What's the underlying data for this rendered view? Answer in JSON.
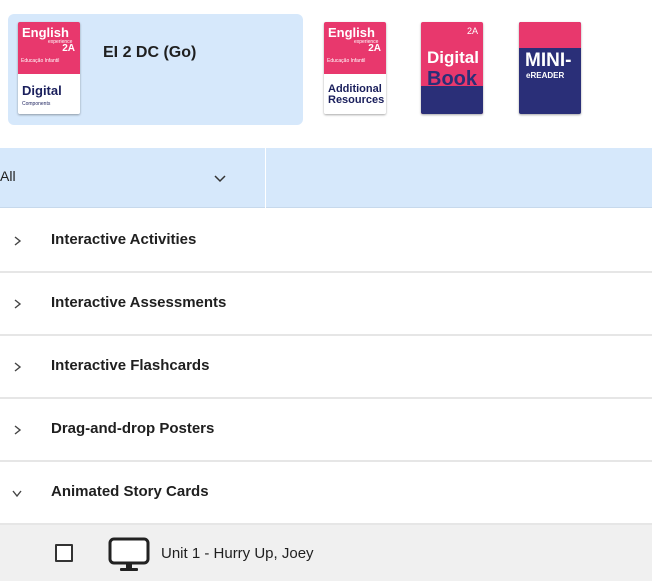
{
  "product_card": {
    "title": "EI 2 DC (Go)",
    "thumb": {
      "brand": "English",
      "brand_sub": "experience",
      "level": "2A",
      "edu": "Educação Infantil",
      "label": "Digital",
      "sublabel": "Components",
      "color": "#e8386d"
    }
  },
  "resources": [
    {
      "name": "additional-resources",
      "brand": "English",
      "brand_sub": "experience",
      "level": "2A",
      "edu": "Educação Infantil",
      "label_line1": "Additional",
      "label_line2": "Resources",
      "color": "#e8386d"
    },
    {
      "name": "digital-book",
      "level": "2A",
      "label_line1": "Digital",
      "label_line2": "Book",
      "top_color": "#e8386d",
      "bottom_color": "#2a2f78"
    },
    {
      "name": "mini-ereader",
      "label_line1": "MINI-",
      "label_line2": "eREADER",
      "top_color": "#e8386d",
      "bottom_color": "#2a2f78"
    }
  ],
  "filter": {
    "value": "All",
    "chevron_icon": "chevron-down-icon"
  },
  "sections": [
    {
      "label": "Interactive Activities",
      "expanded": false
    },
    {
      "label": "Interactive Assessments",
      "expanded": false
    },
    {
      "label": "Interactive Flashcards",
      "expanded": false
    },
    {
      "label": "Drag-and-drop Posters",
      "expanded": false
    },
    {
      "label": "Animated Story Cards",
      "expanded": true
    }
  ],
  "items": [
    {
      "label": "Unit 1 - Hurry Up, Joey",
      "checked": false,
      "icon": "monitor-icon"
    }
  ],
  "colors": {
    "accent_bg": "#d6e8fb",
    "row_divider": "#e6e6e6",
    "child_bg": "#f0f0f0"
  }
}
